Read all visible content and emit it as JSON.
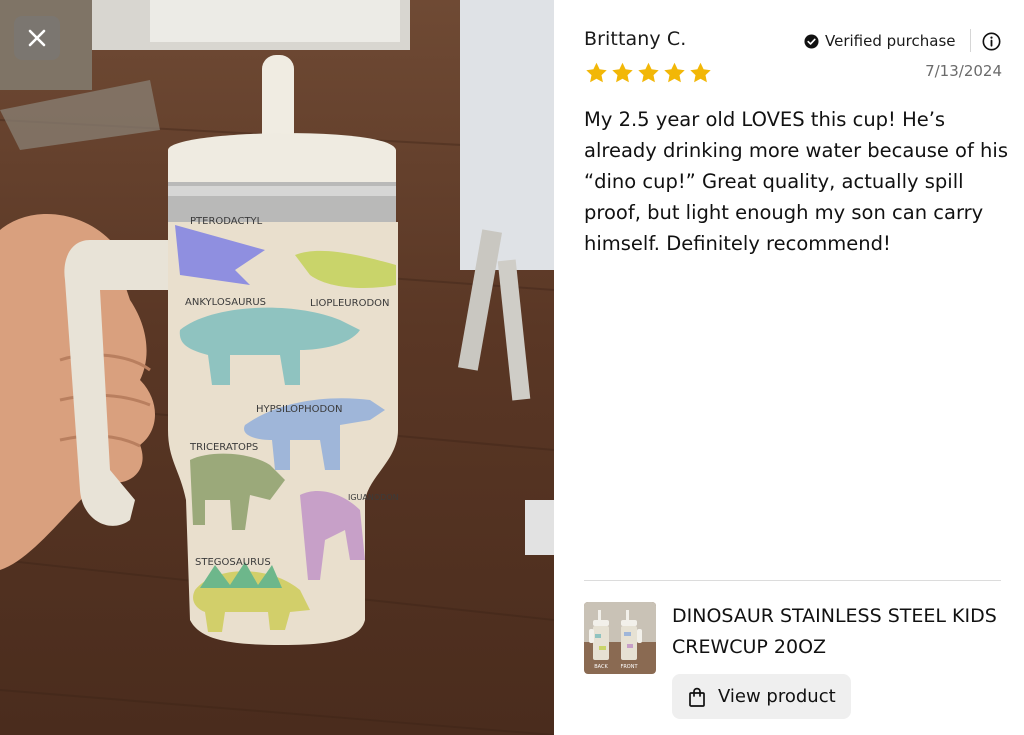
{
  "photo": {
    "alt_subject": "cup",
    "cup_labels": [
      "PTERODACTYL",
      "ANKYLOSAURUS",
      "LIOPLEURODON",
      "HYPSILOPHODON",
      "TRICERATOPS",
      "IGUANODON",
      "STEGOSAURUS"
    ]
  },
  "close_button": {
    "icon": "close-icon"
  },
  "review": {
    "reviewer": "Brittany C.",
    "verified_label": "Verified purchase",
    "rating": 5,
    "rating_max": 5,
    "date": "7/13/2024",
    "body": "My 2.5 year old LOVES this cup! He’s already drinking more water because of his “dino cup!” Great quality, actually spill proof, but light enough my son can carry himself. Definitely recommend!"
  },
  "product": {
    "name": "DINOSAUR STAINLESS STEEL KIDS CREWCUP 20OZ",
    "thumb_labels": [
      "BACK",
      "FRONT"
    ],
    "view_label": "View product"
  },
  "colors": {
    "star": "#F2B707",
    "text": "#111111",
    "muted": "#6B6B6B",
    "button_bg": "#EFEFEF"
  }
}
